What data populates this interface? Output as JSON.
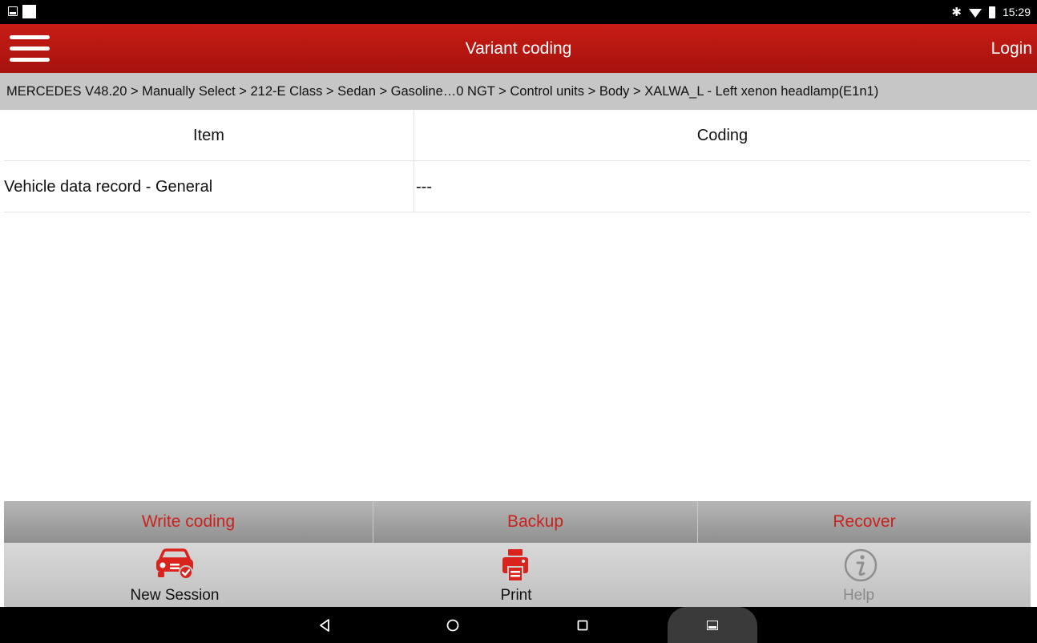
{
  "status_bar": {
    "time": "15:29"
  },
  "header": {
    "title": "Variant coding",
    "login_label": "Login"
  },
  "breadcrumb": "MERCEDES V48.20 > Manually Select > 212-E Class > Sedan > Gasoline…0 NGT > Control units > Body > XALWA_L - Left xenon headlamp(E1n1)",
  "table": {
    "columns": [
      "Item",
      "Coding"
    ],
    "rows": [
      {
        "item": "Vehicle data record - General",
        "coding": "---"
      }
    ]
  },
  "actions": {
    "write_coding": "Write coding",
    "backup": "Backup",
    "recover": "Recover"
  },
  "toolbar": {
    "new_session": "New Session",
    "print": "Print",
    "help": "Help"
  },
  "colors": {
    "header_red": "#b3150f",
    "action_red": "#c8231c",
    "disabled_gray": "#8a8a8a"
  },
  "icons": {
    "menu": "hamburger-icon",
    "new_session": "car-check-icon",
    "print": "printer-icon",
    "help": "info-icon"
  }
}
